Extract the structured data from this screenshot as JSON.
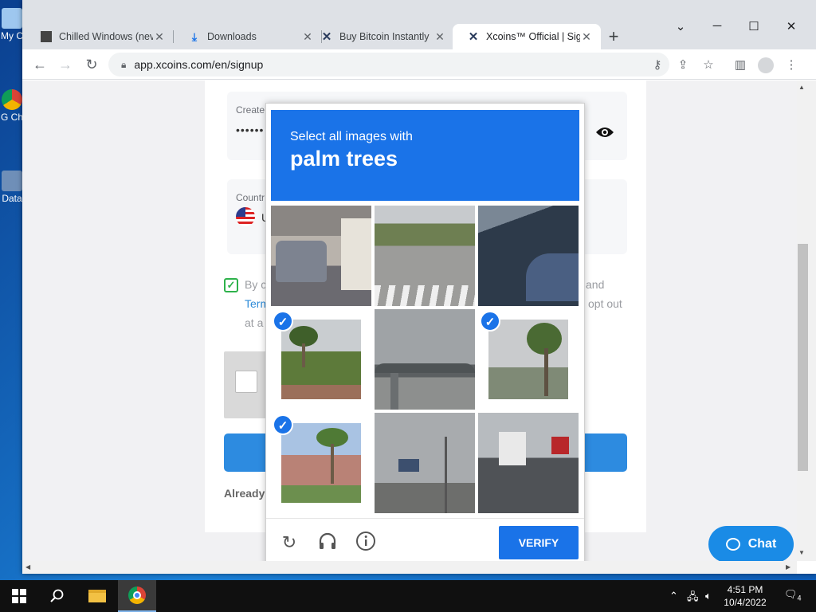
{
  "desktop": {
    "icons": [
      {
        "label": "My C"
      },
      {
        "label": "G Ch"
      },
      {
        "label": "Data"
      }
    ]
  },
  "browser": {
    "tabs": [
      {
        "title": "Chilled Windows (nev",
        "icon": "window-thumb-icon"
      },
      {
        "title": "Downloads",
        "icon": "download-icon"
      },
      {
        "title": "Buy Bitcoin Instantly",
        "icon": "xcoins-icon"
      },
      {
        "title": "Xcoins™ Official | Sig",
        "icon": "xcoins-icon",
        "active": true
      }
    ],
    "url": "app.xcoins.com/en/signup"
  },
  "page": {
    "password_label": "Create",
    "password_value": "••••••",
    "country_label": "Countr",
    "country_value": "U",
    "terms_line1": "By c",
    "terms_link": "Term",
    "terms_line3": "at a",
    "right_frag1": "and",
    "right_frag2": "opt out",
    "already_text": "Already"
  },
  "captcha": {
    "prompt_line1": "Select all images with",
    "prompt_line2": "palm trees",
    "verify_label": "VERIFY",
    "tiles": [
      {
        "scene": "parked car by garage",
        "selected": false
      },
      {
        "scene": "empty road",
        "selected": false
      },
      {
        "scene": "dark blurred object",
        "selected": false
      },
      {
        "scene": "palm trees",
        "selected": true
      },
      {
        "scene": "overpass",
        "selected": false
      },
      {
        "scene": "palm trees",
        "selected": true
      },
      {
        "scene": "palm trees by building",
        "selected": true
      },
      {
        "scene": "billboard and poles",
        "selected": false
      },
      {
        "scene": "street with bus",
        "selected": false
      }
    ]
  },
  "chat": {
    "label": "Chat"
  },
  "taskbar": {
    "time": "4:51 PM",
    "date": "10/4/2022",
    "notifications": "4"
  }
}
